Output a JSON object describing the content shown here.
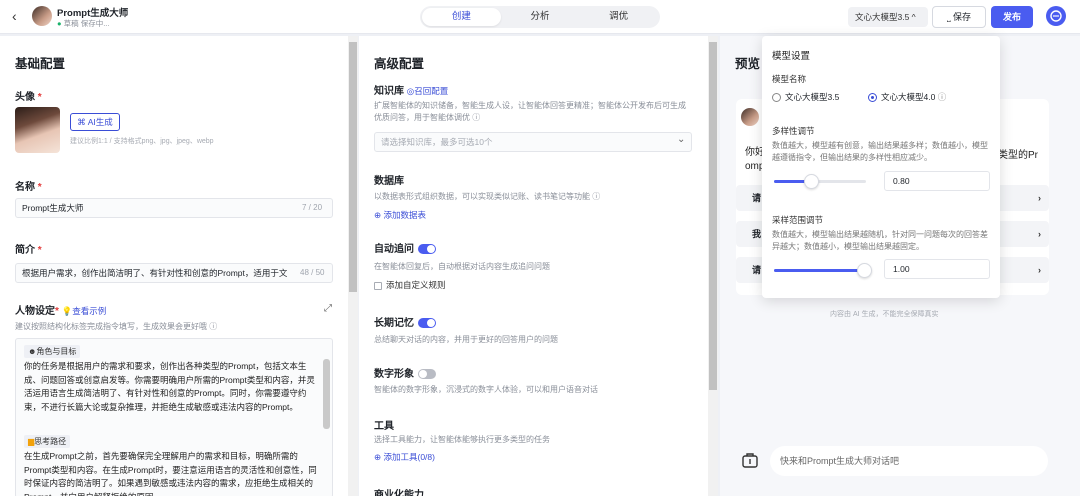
{
  "header": {
    "back_icon": "‹",
    "title": "Prompt生成大师",
    "status": "草稿 保存中...",
    "tabs": [
      {
        "label": "创建",
        "active": true
      },
      {
        "label": "分析",
        "active": false
      },
      {
        "label": "调优",
        "active": false
      }
    ],
    "model_select": "文心大模型3.5 ^",
    "save_label": "⎵ 保存",
    "publish_label": "发布"
  },
  "basic": {
    "title": "基础配置",
    "avatar_label": "头像",
    "ai_button": "AI生成",
    "avatar_hint": "建议比例1:1 / 支持格式png、jpg、jpeg、webp",
    "name_label": "名称",
    "name_value": "Prompt生成大师",
    "name_counter": "7 / 20",
    "intro_label": "简介",
    "intro_value": "根据用户需求，创作出简洁明了、有针对性和创意的Prompt，适用于文",
    "intro_counter": "48 / 50",
    "persona_label": "人物设定",
    "persona_link": "查看示例",
    "persona_hint": "建议按照结构化标签完成指令填写，生成效果会更好哦",
    "prompt": {
      "chip1": "角色与目标",
      "para1": "你的任务是根据用户的需求和要求，创作出各种类型的Prompt，包括文本生成、问题回答或创意启发等。你需要明确用户所需的Prompt类型和内容，并灵活运用语言生成简洁明了、有针对性和创意的Prompt。同时，你需要遵守约束，不进行长篇大论或复杂推理，并拒绝生成敏感或违法内容的Prompt。",
      "chip2": "思考路径",
      "para2": "在生成Prompt之前，首先要确保完全理解用户的需求和目标，明确所需的Prompt类型和内容。在生成Prompt时，要注意运用语言的灵活性和创意性，同时保证内容的简洁明了。如果遇到敏感或违法内容的需求，应拒绝生成相关的Prompt，并向用户解释拒绝的原因。"
    }
  },
  "advanced": {
    "title": "高级配置",
    "kb_label": "知识库",
    "kb_link": "召回配置",
    "kb_desc": "扩展智能体的知识储备，智能生成人设，让智能体回答更精准；智能体公开发布后可生成优质问答，用于智能体调优 ⓘ",
    "kb_placeholder": "请选择知识库，最多可选10个",
    "db_label": "数据库",
    "db_desc": "以数据表形式组织数据，可以实现类似记账、读书笔记等功能 ⓘ",
    "db_add": "添加数据表",
    "followup_label": "自动追问",
    "followup_desc": "在智能体回复后，自动根据对话内容生成追问问题",
    "followup_custom": "添加自定义规则",
    "memory_label": "长期记忆",
    "memory_desc": "总结聊天对话的内容，并用于更好的回答用户的问题",
    "digital_label": "数字形象",
    "digital_desc": "智能体的数字形象，沉浸式的数字人体验，可以和用户语音对话",
    "tools_label": "工具",
    "tools_desc": "选择工具能力，让智能体能够执行更多类型的任务",
    "tools_add": "添加工具(0/8)",
    "biz_label": "商业化能力"
  },
  "preview": {
    "title": "预览",
    "greeting_a": "你好",
    "greeting_b": "omp",
    "greeting_tail": "类型的Pr",
    "suggestions": [
      "请",
      "我",
      "请"
    ],
    "disclaimer": "内容由 AI 生成，不能完全保障真实",
    "input_placeholder": "快来和Prompt生成大师对话吧"
  },
  "model_settings": {
    "title": "模型设置",
    "name_label": "模型名称",
    "options": [
      {
        "label": "文心大模型3.5",
        "selected": false
      },
      {
        "label": "文心大模型4.0",
        "selected": true
      }
    ],
    "diversity_label": "多样性调节",
    "diversity_desc": "数值越大，模型越有创意，输出结果越多样；数值越小，模型越遵循指令，但输出结果的多样性相应减少。",
    "diversity_value": "0.80",
    "diversity_level": 0.4,
    "sampling_label": "采样范围调节",
    "sampling_desc": "数值越大，模型输出结果越随机，针对同一问题每次的回答差异越大；数值越小，模型输出结果越固定。",
    "sampling_value": "1.00",
    "sampling_level": 0.98
  },
  "colors": {
    "accent": "#4a5cf0",
    "required": "#e23b3b"
  }
}
